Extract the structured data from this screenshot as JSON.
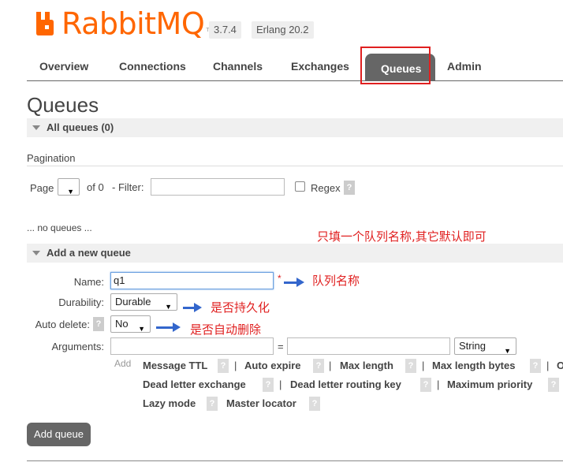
{
  "header": {
    "logo_text": "RabbitMQ",
    "logo_tm": "TM",
    "version": "3.7.4",
    "erlang": "Erlang 20.2",
    "brand_color": "#ff6600"
  },
  "nav": {
    "tabs": [
      {
        "label": "Overview"
      },
      {
        "label": "Connections"
      },
      {
        "label": "Channels"
      },
      {
        "label": "Exchanges"
      },
      {
        "label": "Queues",
        "active": true
      },
      {
        "label": "Admin"
      }
    ]
  },
  "page": {
    "title": "Queues",
    "all_queues": "All queues (0)",
    "pagination_label": "Pagination",
    "page_label": "Page",
    "page_value": "",
    "of_text": "of 0",
    "filter_label": "- Filter:",
    "filter_value": "",
    "regex_label": "Regex",
    "help": "?",
    "no_queues": "... no queues ..."
  },
  "add_queue": {
    "section_title": "Add a new queue",
    "name_label": "Name:",
    "name_value": "q1",
    "required_mark": "*",
    "durability_label": "Durability:",
    "durability_value": "Durable",
    "auto_delete_label": "Auto delete:",
    "auto_delete_value": "No",
    "arguments_label": "Arguments:",
    "arg_key": "",
    "equals": "=",
    "arg_value": "",
    "arg_type": "String",
    "add_label": "Add",
    "arg_links_row1": [
      "Message TTL",
      "Auto expire",
      "Max length",
      "Max length bytes"
    ],
    "arg_row1_tail": "O",
    "arg_links_row2": [
      "Dead letter exchange",
      "Dead letter routing key",
      "Maximum priority"
    ],
    "arg_links_row3": [
      "Lazy mode",
      "Master locator"
    ],
    "separator": "|",
    "submit": "Add queue"
  },
  "annotations": {
    "top_note": "只填一个队列名称,其它默认即可",
    "name_note": "队列名称",
    "durability_note": "是否持久化",
    "auto_delete_note": "是否自动删除"
  }
}
